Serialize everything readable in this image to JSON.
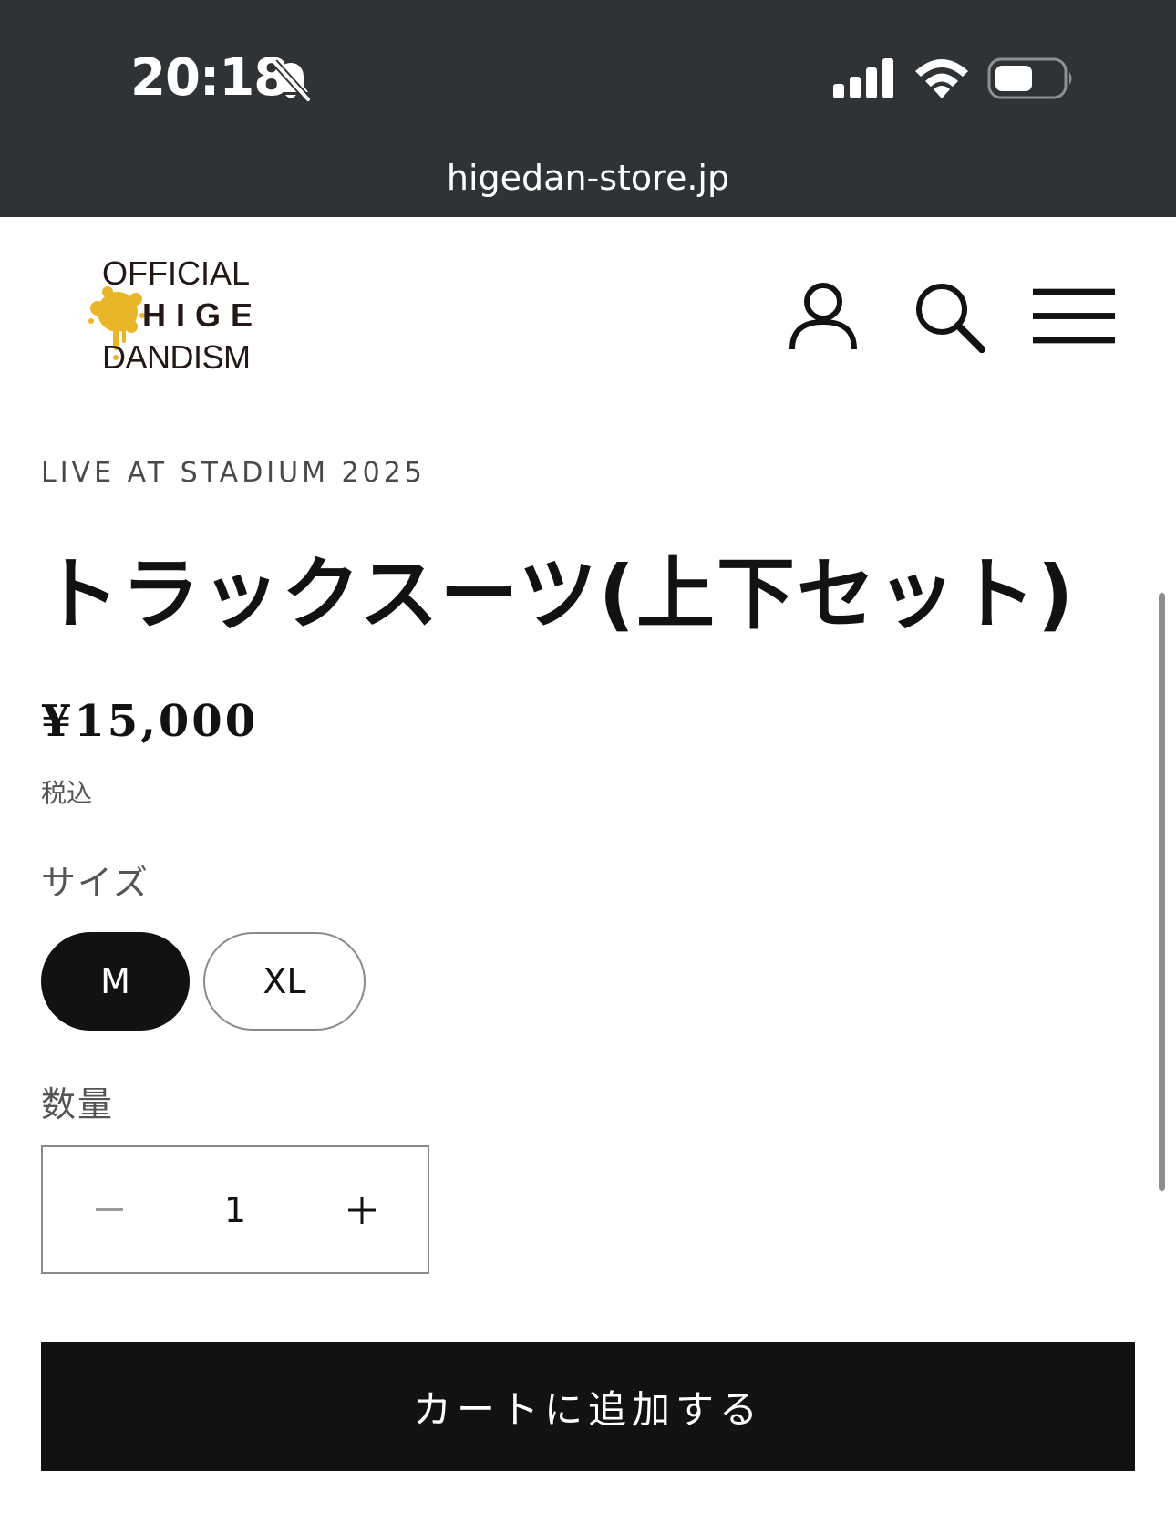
{
  "status_bar": {
    "time": "20:18",
    "url": "higedan-store.jp",
    "icons": [
      "mute-bell-icon",
      "signal-icon",
      "wifi-icon",
      "battery-icon"
    ]
  },
  "header": {
    "logo": {
      "line1": "OFFICIAL",
      "line2": "HIGE",
      "line3": "DANDISM"
    },
    "icons": [
      "account-icon",
      "search-icon",
      "menu-icon"
    ]
  },
  "product": {
    "collection": "LIVE AT STADIUM 2025",
    "title": "トラックスーツ(上下セット)",
    "price": "¥15,000",
    "tax_note": "税込",
    "size_label": "サイズ",
    "sizes": [
      {
        "label": "M",
        "selected": true
      },
      {
        "label": "XL",
        "selected": false
      }
    ],
    "quantity_label": "数量",
    "quantity": "1",
    "add_to_cart": "カートに追加する"
  },
  "colors": {
    "status_bar_bg": "#303335",
    "primary": "#121212",
    "muted_text": "#555555",
    "border": "#8a8a8a",
    "logo_splash": "#e8b628"
  }
}
